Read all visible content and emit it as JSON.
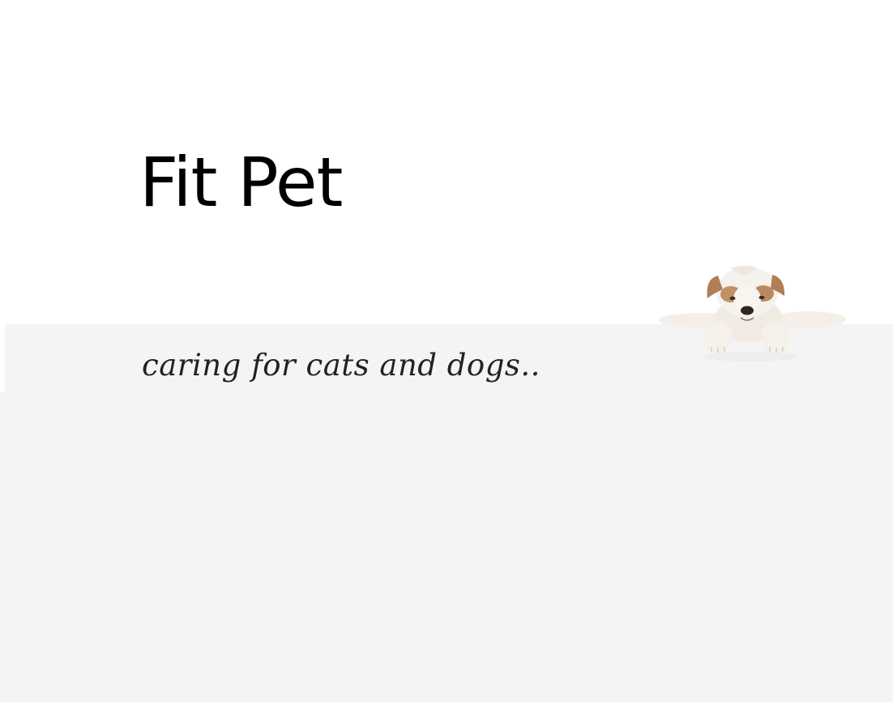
{
  "site": {
    "title": "Fit Pet",
    "tagline": "caring for cats and dogs.."
  },
  "colors": {
    "background": "#ffffff",
    "band": "#f4f4f4",
    "title": "#000000",
    "tagline": "#222222",
    "puppy_fur": "#f3eee8",
    "puppy_patch": "#a9784f"
  },
  "images": {
    "hero": "puppy-illustration"
  }
}
